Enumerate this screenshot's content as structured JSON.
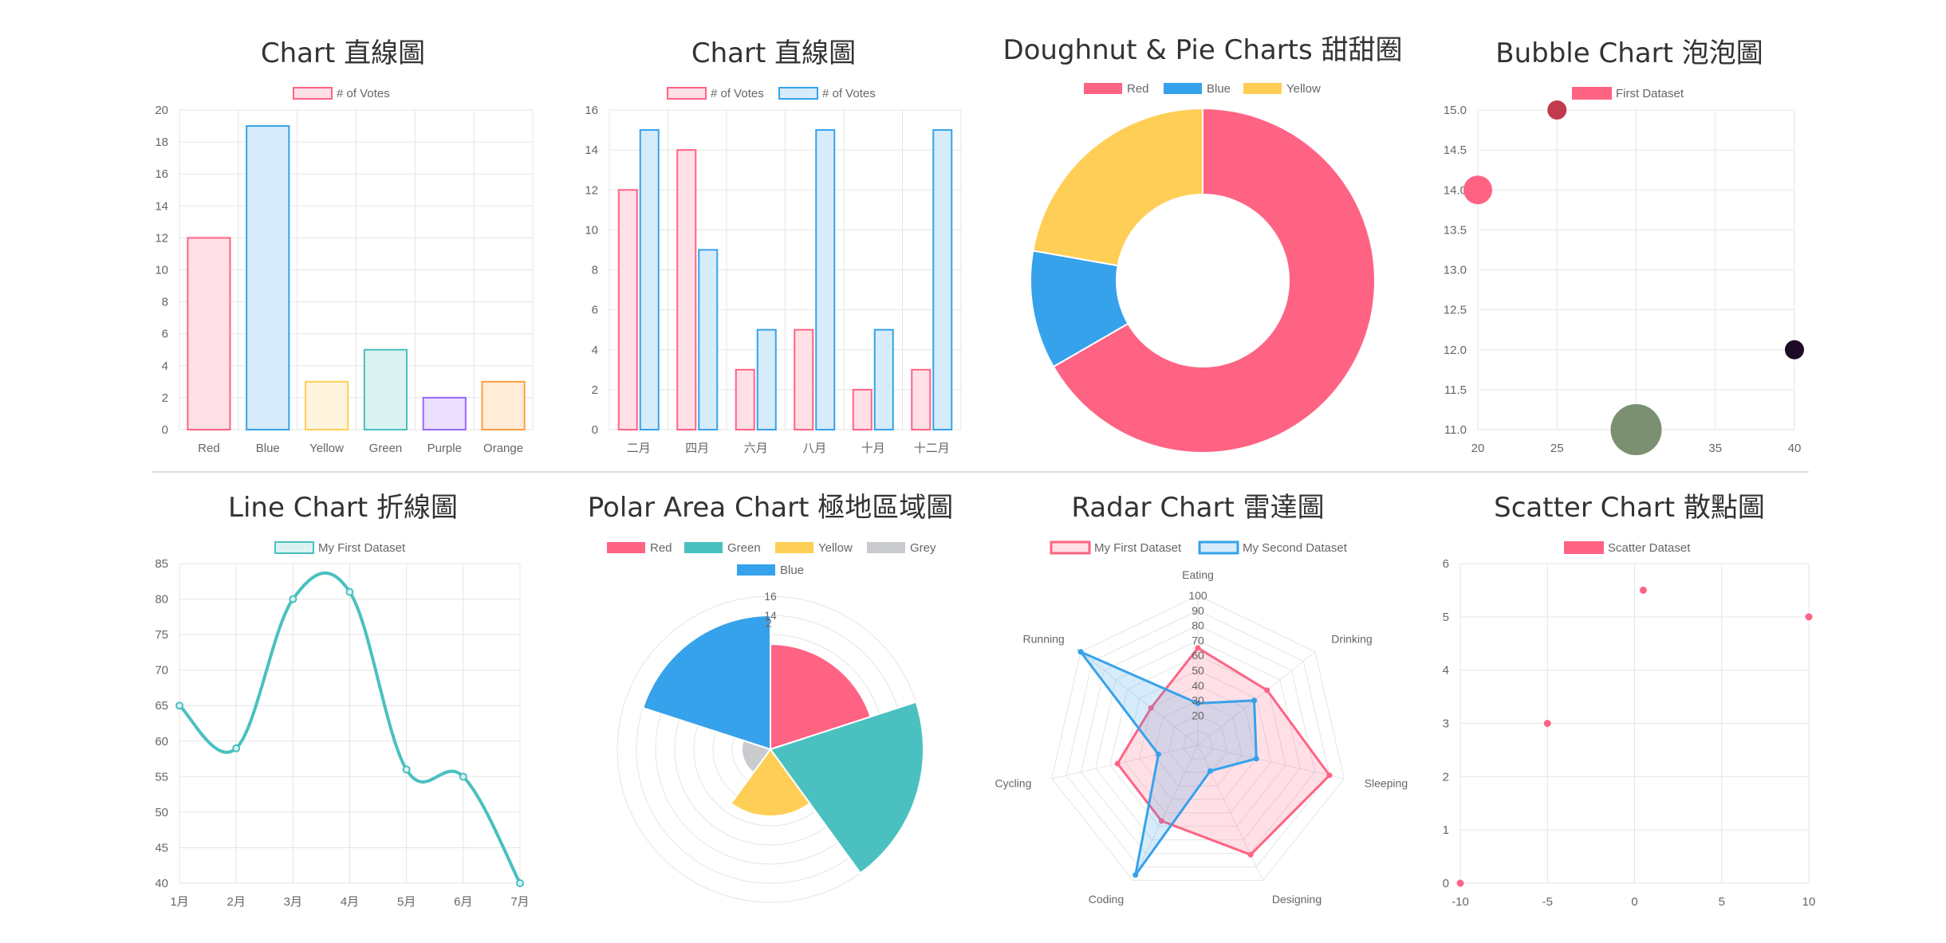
{
  "chart_data": [
    {
      "type": "bar",
      "title": "Chart 直線圖",
      "categories": [
        "Red",
        "Blue",
        "Yellow",
        "Green",
        "Purple",
        "Orange"
      ],
      "series": [
        {
          "name": "# of Votes",
          "values": [
            12,
            19,
            3,
            5,
            2,
            3
          ]
        }
      ],
      "bar_fills": [
        "#FFE0E6",
        "#D7ECFB",
        "#FFF5DD",
        "#DBF2F2",
        "#EBE0FF",
        "#FFECD9"
      ],
      "bar_strokes": [
        "#FF6384",
        "#36A2EB",
        "#FFCE56",
        "#4BC0C0",
        "#9966FF",
        "#FF9F40"
      ],
      "yticks": [
        "0",
        "2",
        "4",
        "6",
        "8",
        "10",
        "12",
        "14",
        "16",
        "18",
        "20"
      ],
      "ylim": [
        0,
        20
      ],
      "legend": "top"
    },
    {
      "type": "bar",
      "title": "Chart 直線圖",
      "categories": [
        "二月",
        "四月",
        "六月",
        "八月",
        "十月",
        "十二月"
      ],
      "series": [
        {
          "name": "# of Votes",
          "values": [
            12,
            14,
            3,
            5,
            2,
            3
          ],
          "fill": "#FFE0E6",
          "stroke": "#FF6384"
        },
        {
          "name": "# of Votes",
          "values": [
            15,
            9,
            5,
            15,
            5,
            15
          ],
          "fill": "#D7ECFB",
          "stroke": "#36A2EB"
        }
      ],
      "yticks": [
        "0",
        "2",
        "4",
        "6",
        "8",
        "10",
        "12",
        "14",
        "16"
      ],
      "ylim": [
        0,
        16
      ],
      "legend": "top"
    },
    {
      "type": "pie",
      "title": "Doughnut & Pie Charts 甜甜圈",
      "labels": [
        "Red",
        "Blue",
        "Yellow"
      ],
      "values": [
        300,
        50,
        100
      ],
      "colors": [
        "#FF6384",
        "#36A2EB",
        "#FFCE56"
      ],
      "doughnut": true,
      "legend": "top"
    },
    {
      "type": "scatter",
      "title": "Bubble Chart 泡泡圖",
      "series": [
        {
          "name": "First Dataset",
          "color": "#FF6384",
          "points": [
            {
              "x": 20,
              "y": 14,
              "r": 18,
              "color": "#FF6384"
            },
            {
              "x": 25,
              "y": 15,
              "r": 12,
              "color": "#C23A4E"
            },
            {
              "x": 30,
              "y": 11,
              "r": 32,
              "color": "#7B9070"
            },
            {
              "x": 40,
              "y": 12,
              "r": 12,
              "color": "#1D0A24"
            }
          ]
        }
      ],
      "xticks": [
        "20",
        "25",
        "30",
        "35",
        "40"
      ],
      "yticks": [
        "11.0",
        "11.5",
        "12.0",
        "12.5",
        "13.0",
        "13.5",
        "14.0",
        "14.5",
        "15.0"
      ],
      "xlim": [
        20,
        40
      ],
      "ylim": [
        11,
        15
      ],
      "legend": "top"
    },
    {
      "type": "line",
      "title": "Line Chart 折線圖",
      "categories": [
        "1月",
        "2月",
        "3月",
        "4月",
        "5月",
        "6月",
        "7月"
      ],
      "series": [
        {
          "name": "My First Dataset",
          "values": [
            65,
            59,
            80,
            81,
            56,
            55,
            40
          ],
          "color": "#4BC0C0"
        }
      ],
      "yticks": [
        "40",
        "45",
        "50",
        "55",
        "60",
        "65",
        "70",
        "75",
        "80",
        "85"
      ],
      "ylim": [
        40,
        85
      ],
      "legend": "top"
    },
    {
      "type": "pie",
      "title": "Polar Area Chart 極地區域圖",
      "polar": true,
      "labels": [
        "Red",
        "Green",
        "Yellow",
        "Grey",
        "Blue"
      ],
      "values": [
        11,
        16,
        7,
        3,
        14
      ],
      "colors": [
        "#FF6384",
        "#4BC0C0",
        "#FFCE56",
        "#C9CBCF",
        "#36A2EB"
      ],
      "rticks": [
        "2",
        "14",
        "16"
      ],
      "rlim": [
        0,
        16
      ],
      "legend": "top"
    },
    {
      "type": "line",
      "title": "Radar Chart 雷達圖",
      "radar": true,
      "labels": [
        "Eating",
        "Drinking",
        "Sleeping",
        "Designing",
        "Coding",
        "Cycling",
        "Running"
      ],
      "series": [
        {
          "name": "My First Dataset",
          "values": [
            65,
            59,
            90,
            81,
            56,
            55,
            40
          ],
          "color": "#FF6384",
          "fill": "rgba(255,99,132,0.2)"
        },
        {
          "name": "My Second Dataset",
          "values": [
            28,
            48,
            40,
            19,
            96,
            27,
            100
          ],
          "color": "#36A2EB",
          "fill": "rgba(54,162,235,0.2)"
        }
      ],
      "rticks": [
        "20",
        "30",
        "40",
        "50",
        "60",
        "70",
        "80",
        "90",
        "100"
      ],
      "rlim": [
        0,
        100
      ],
      "legend": "top"
    },
    {
      "type": "scatter",
      "title": "Scatter Chart 散點圖",
      "series": [
        {
          "name": "Scatter Dataset",
          "color": "#FF6384",
          "points": [
            {
              "x": -10,
              "y": 0
            },
            {
              "x": -5,
              "y": 3
            },
            {
              "x": 0.5,
              "y": 5.5
            },
            {
              "x": 10,
              "y": 5
            }
          ]
        }
      ],
      "xticks": [
        "-10",
        "-5",
        "0",
        "5",
        "10"
      ],
      "yticks": [
        "0",
        "1",
        "2",
        "3",
        "4",
        "5",
        "6"
      ],
      "xlim": [
        -10,
        10
      ],
      "ylim": [
        0,
        6
      ],
      "legend": "top"
    }
  ]
}
